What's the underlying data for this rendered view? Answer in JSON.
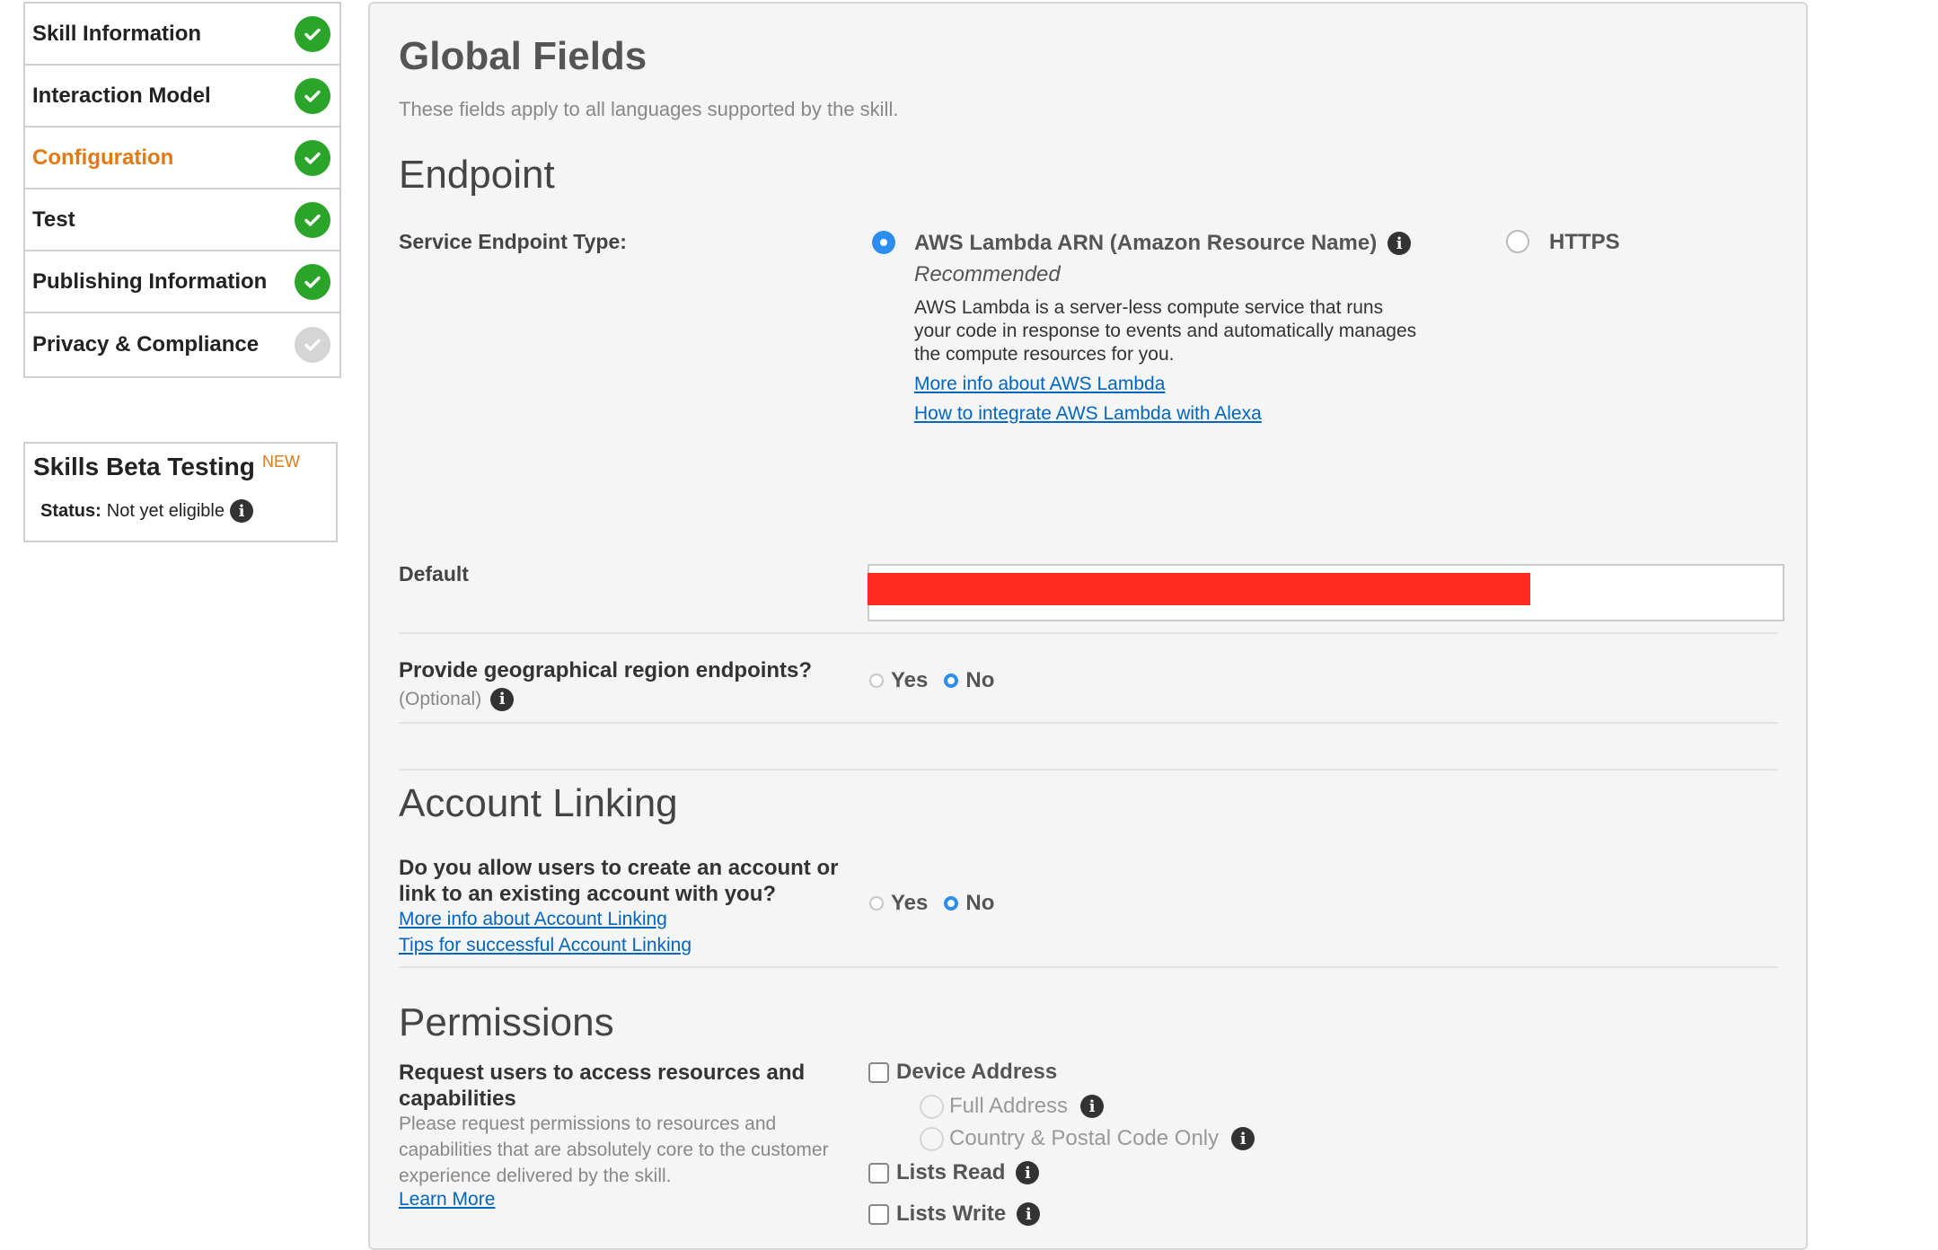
{
  "sidebar": {
    "items": [
      {
        "label": "Skill Information",
        "status": "complete"
      },
      {
        "label": "Interaction Model",
        "status": "complete"
      },
      {
        "label": "Configuration",
        "status": "complete",
        "active": true
      },
      {
        "label": "Test",
        "status": "complete"
      },
      {
        "label": "Publishing Information",
        "status": "complete"
      },
      {
        "label": "Privacy & Compliance",
        "status": "pending"
      }
    ],
    "beta": {
      "title": "Skills Beta Testing",
      "badge": "NEW",
      "status_label": "Status:",
      "status_value": "Not yet eligible"
    }
  },
  "main": {
    "title": "Global Fields",
    "subtitle": "These fields apply to all languages supported by the skill.",
    "endpoint": {
      "heading": "Endpoint",
      "type_label": "Service Endpoint Type:",
      "lambda_label": "AWS Lambda ARN (Amazon Resource Name)",
      "lambda_recommended": "Recommended",
      "lambda_desc": "AWS Lambda is a server-less compute service that runs your code in response to events and automatically manages the compute resources for you.",
      "link_more": "More info about AWS Lambda",
      "link_integrate": "How to integrate AWS Lambda with Alexa",
      "https_label": "HTTPS",
      "selected": "lambda",
      "default_label": "Default",
      "default_value": "",
      "geo_label": "Provide geographical region endpoints?",
      "geo_optional": "(Optional)",
      "geo_yes": "Yes",
      "geo_no": "No",
      "geo_selected": "No"
    },
    "account_linking": {
      "heading": "Account Linking",
      "question": "Do you allow users to create an account or link to an existing account with you?",
      "link_more": "More info about Account Linking",
      "link_tips": "Tips for successful Account Linking",
      "yes": "Yes",
      "no": "No",
      "selected": "No"
    },
    "permissions": {
      "heading": "Permissions",
      "label": "Request users to access resources and capabilities",
      "desc": "Please request permissions to resources and capabilities that are absolutely core to the customer experience delivered by the skill.",
      "learn_more": "Learn More",
      "device_address": "Device Address",
      "full_address": "Full Address",
      "country_postal": "Country & Postal Code Only",
      "lists_read": "Lists Read",
      "lists_write": "Lists Write"
    }
  },
  "colors": {
    "complete": "#2aa52a",
    "pending": "#d5d5d5",
    "active_nav": "#e47911",
    "link": "#0066c0",
    "radio_selected": "#2d8ef0"
  }
}
